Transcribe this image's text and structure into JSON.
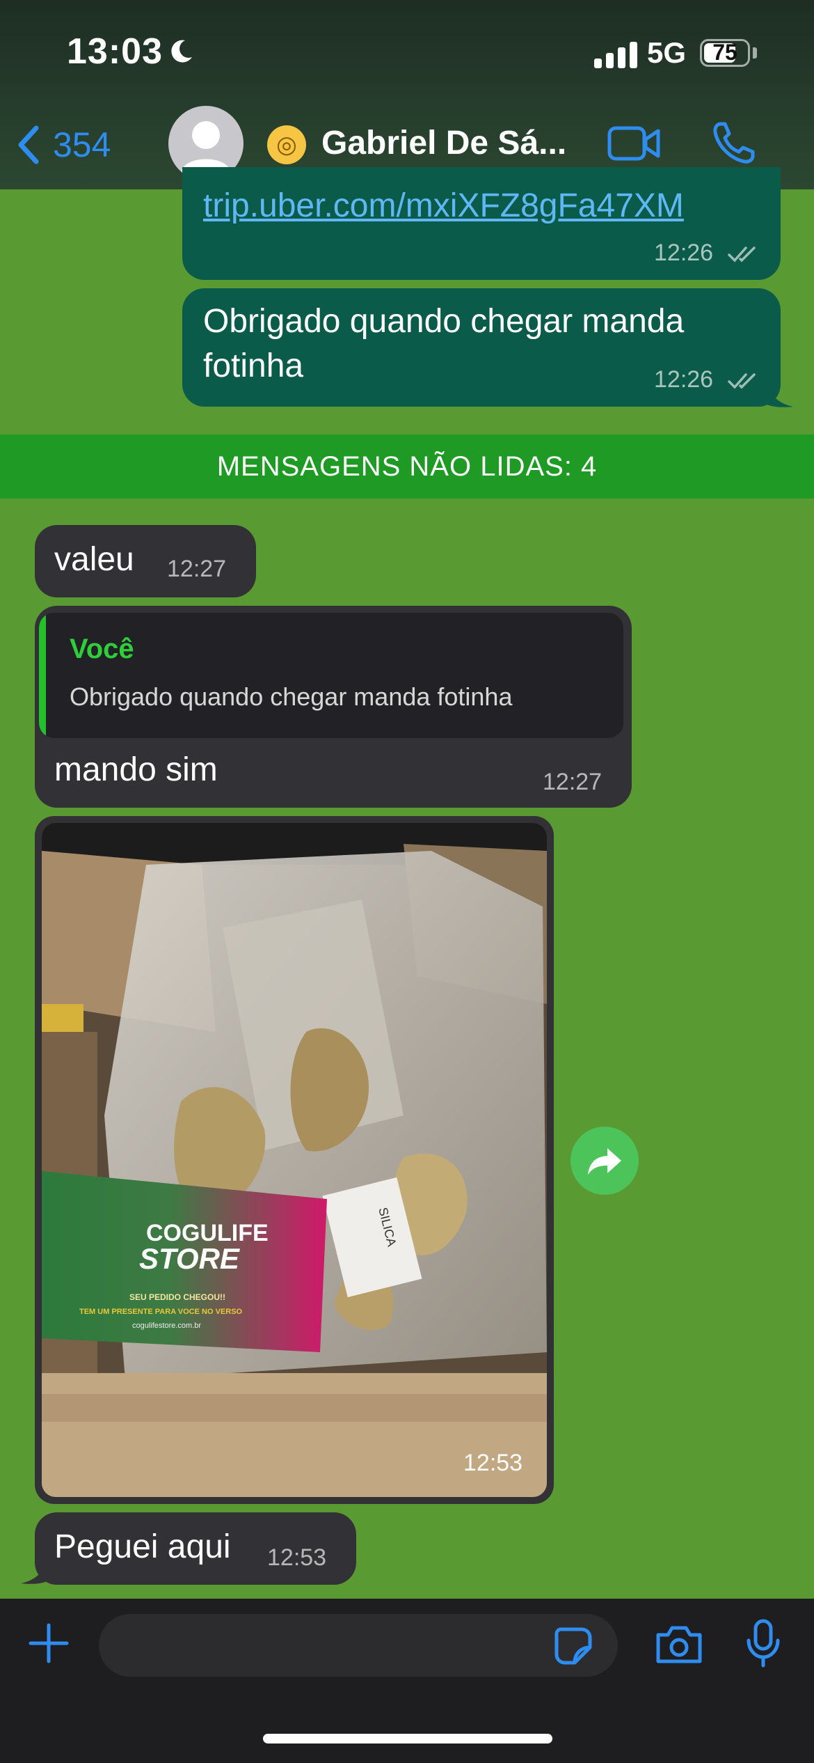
{
  "status_bar": {
    "time": "13:03",
    "network": "5G",
    "battery": "75",
    "battery_level": 0.75
  },
  "header": {
    "back_count": "354",
    "contact_name": "Gabriel De Sá..."
  },
  "messages": {
    "m1": {
      "link": "trip.uber.com/mxiXFZ8gFa47XM",
      "time": "12:26"
    },
    "m2": {
      "text": "Obrigado quando chegar manda fotinha",
      "time": "12:26"
    },
    "unread_label": "MENSAGENS NÃO LIDAS: 4",
    "m3": {
      "text": "valeu",
      "time": "12:27"
    },
    "m4": {
      "quote_author": "Você",
      "quote_text": "Obrigado quando chegar manda fotinha",
      "text": "mando sim",
      "time": "12:27"
    },
    "m5": {
      "time": "12:53"
    },
    "m6": {
      "text": "Peguei aqui",
      "time": "12:53"
    }
  },
  "photo_card": {
    "brand_line1": "COGULIFE",
    "brand_line2": "STORE",
    "tagline": "SEU PEDIDO CHEGOU!!",
    "subtitle": "TEM UM PRESENTE PARA VOCE NO VERSO",
    "site": "cogulifestore.com.br"
  },
  "photo_label": "SILICA",
  "input": {
    "placeholder": ""
  },
  "colors": {
    "accent": "#2f8cf0",
    "outgoing": "#0b5b4b",
    "incoming": "#323236",
    "unread": "#1f9a24",
    "wallpaper": "#5a9a32"
  }
}
